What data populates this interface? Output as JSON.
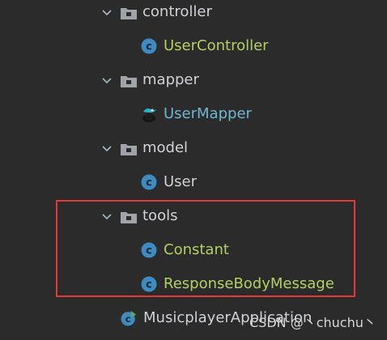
{
  "project_tree": {
    "folders": {
      "controller": "controller",
      "mapper": "mapper",
      "model": "model",
      "tools": "tools"
    },
    "classes": {
      "user_controller": "UserController",
      "user_mapper": "UserMapper",
      "user": "User",
      "constant": "Constant",
      "response_body_message": "ResponseBodyMessage",
      "musicplayer_application": "MusicplayerApplication"
    }
  },
  "watermark": "CSDN @丶chuchu丶",
  "icons": {
    "folder": "folder-icon",
    "class": "class-c-icon",
    "mapper": "mybatis-mapper-icon",
    "app": "spring-app-icon"
  },
  "colors": {
    "background": "#2b2b2b",
    "folder_text": "#cfd2d6",
    "modified_text": "#b5cf63",
    "interface_text": "#6fb6d3",
    "highlight_box": "#e53935"
  }
}
